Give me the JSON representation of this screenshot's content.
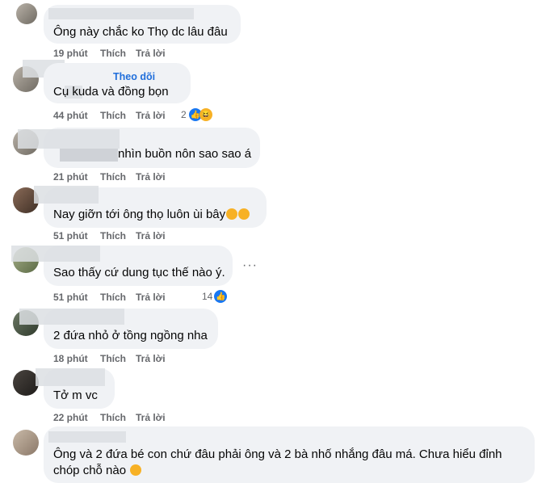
{
  "comments": [
    {
      "author": "",
      "text": "Ông này chắc ko Thọ dc lâu đâu",
      "time": "19 phút",
      "like": "Thích",
      "reply": "Trả lời"
    },
    {
      "author": "",
      "follow": "Theo dõi",
      "text": "Cụ kuda và đồng bọn",
      "time": "44 phút",
      "like": "Thích",
      "reply": "Trả lời",
      "reactions": "2",
      "reaction_icons": [
        "like-icon",
        "haha-icon"
      ]
    },
    {
      "author": "",
      "text": "nhìn buồn nôn sao sao á",
      "time": "21 phút",
      "like": "Thích",
      "reply": "Trả lời"
    },
    {
      "author": "",
      "text": "Nay giỡn tới ông thọ luôn ùi bây",
      "time": "51 phút",
      "like": "Thích",
      "reply": "Trả lời",
      "emojis": [
        "rofl-emoji",
        "rofl-emoji"
      ]
    },
    {
      "author": "",
      "text": "Sao thấy cứ dung tục thế nào ý.",
      "time": "51 phút",
      "like": "Thích",
      "reply": "Trả lời",
      "reactions": "14",
      "reaction_icons": [
        "like-icon"
      ],
      "more": "···"
    },
    {
      "author": "",
      "text": "2 đứa nhỏ ở tồng ngồng nha",
      "time": "18 phút",
      "like": "Thích",
      "reply": "Trả lời"
    },
    {
      "author": "",
      "text": "Tở m vc",
      "time": "22 phút",
      "like": "Thích",
      "reply": "Trả lời"
    },
    {
      "author": "",
      "text_line1": "Ông và 2 đứa bé con chứ đâu phải ông và 2 bà nhố nhắng đâu má. Chưa hiểu đỉnh",
      "text_line2": "chóp chỗ nào",
      "emojis": [
        "eye-roll-emoji"
      ]
    }
  ],
  "colors": {
    "bubble": "#f0f2f5",
    "meta": "#65676b",
    "link": "#216fdb",
    "like": "#1877f2"
  }
}
